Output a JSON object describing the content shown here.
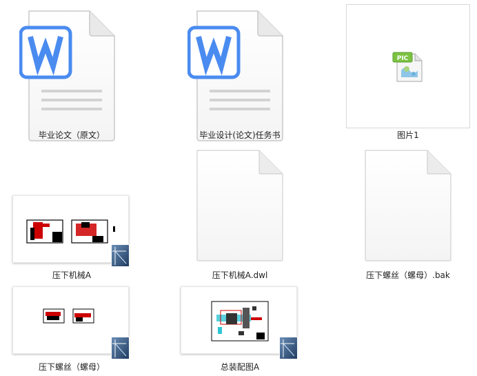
{
  "files": [
    {
      "id": "doc1",
      "name": "毕业论文（原文）",
      "type": "word"
    },
    {
      "id": "doc2",
      "name": "毕业设计(论文)任务书",
      "type": "word"
    },
    {
      "id": "pic1",
      "name": "图片1",
      "type": "picture",
      "icon_text": "PIC"
    },
    {
      "id": "dwg1",
      "name": "压下机械A",
      "type": "cad-thumbnail"
    },
    {
      "id": "dwl1",
      "name": "压下机械A.dwl",
      "type": "blank"
    },
    {
      "id": "bak1",
      "name": "压下螺丝（螺母）.bak",
      "type": "blank"
    },
    {
      "id": "dwg2",
      "name": "压下螺丝（螺母）",
      "type": "cad-thumbnail"
    },
    {
      "id": "dwg3",
      "name": "总装配图A",
      "type": "cad-thumbnail"
    }
  ],
  "colors": {
    "word_blue": "#4a8bf0",
    "pic_green": "#7cc242",
    "cad_badge": "#2d4f7a"
  }
}
